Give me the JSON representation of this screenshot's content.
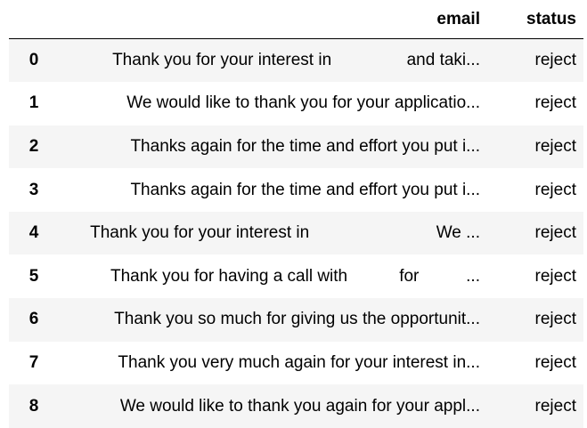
{
  "table": {
    "columns": [
      "",
      "email",
      "status"
    ],
    "rows": [
      {
        "index": "0",
        "email": "Thank you for your interest in                and taki...",
        "status": "reject"
      },
      {
        "index": "1",
        "email": "We would like to thank you for your applicatio...",
        "status": "reject"
      },
      {
        "index": "2",
        "email": "Thanks again for the time and effort you put i...",
        "status": "reject"
      },
      {
        "index": "3",
        "email": "Thanks again for the time and effort you put i...",
        "status": "reject"
      },
      {
        "index": "4",
        "email": "Thank you for your interest in                           We ...",
        "status": "reject"
      },
      {
        "index": "5",
        "email": "Thank you for having a call with           for          ...",
        "status": "reject"
      },
      {
        "index": "6",
        "email": "Thank you so much for giving us the opportunit...",
        "status": "reject"
      },
      {
        "index": "7",
        "email": "Thank you very much again for your interest in...",
        "status": "reject"
      },
      {
        "index": "8",
        "email": "We would like to thank you again for your appl...",
        "status": "reject"
      }
    ]
  }
}
